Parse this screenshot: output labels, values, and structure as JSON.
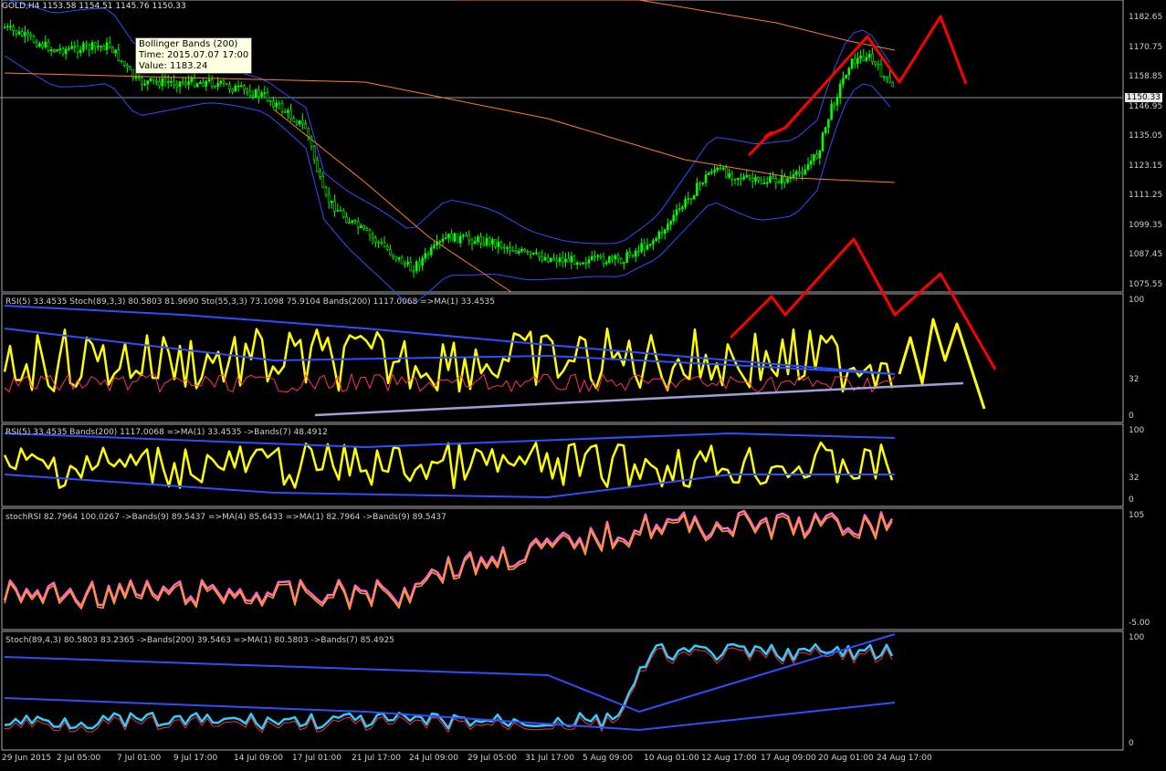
{
  "header": {
    "title": "GOLD,H4  1153.58 1154.51 1145.76 1150.33"
  },
  "tooltip": {
    "line1": "Bollinger Bands (200)",
    "line2": "Time: 2015.07.07 17:00",
    "line3": "Value: 1183.24"
  },
  "current_price": "1150.33",
  "panes": {
    "rsi_stoch": "RSI(5) 33.4535  Stoch(89,3,3) 80.5803 81.9690  Sto(55,3,3) 73.1098 75.9104  Bands(200) 1117.0068  =>MA(1) 33.4535",
    "rsi_bands": "RSI(5) 33.4535  Bands(200) 1117.0068  =>MA(1) 33.4535  ->Bands(7) 48.4912",
    "stoch_rsi": "stochRSI 82.7964 100.0267  ->Bands(9) 89.5437  =>MA(4) 85.6433  =>MA(1) 82.7964  ->Bands(9) 89.5437",
    "stoch": "Stoch(89,4,3) 80.5803 83.2365  ->Bands(200) 39.5463  =>MA(1) 80.5803  ->Bands(7) 85.4925"
  },
  "price_axis": [
    "1182.65",
    "1170.75",
    "1158.85",
    "1146.95",
    "1135.05",
    "1123.15",
    "1111.25",
    "1099.35",
    "1087.45",
    "1075.55"
  ],
  "rsi_axis": [
    "100",
    "32",
    "0"
  ],
  "rsi2_axis": [
    "100",
    "32",
    "0"
  ],
  "stochrsi_axis": [
    "105",
    "-5.00"
  ],
  "stoch_axis": [
    "100",
    "0"
  ],
  "time_axis": [
    "29 Jun 2015",
    "2 Jul 05:00",
    "7 Jul 01:00",
    "9 Jul 17:00",
    "14 Jul 09:00",
    "17 Jul 01:00",
    "21 Jul 17:00",
    "24 Jul 09:00",
    "29 Jul 05:00",
    "31 Jul 17:00",
    "5 Aug 09:00",
    "10 Aug 01:00",
    "12 Aug 17:00",
    "17 Aug 09:00",
    "20 Aug 01:00",
    "24 Aug 17:00"
  ],
  "colors": {
    "up_candle": "#00ff00",
    "band": "#2f4fff",
    "ma": "#ff7f27",
    "rsi": "#ffff00",
    "arrow": "#ff0000",
    "trend": "#a0a0d8"
  },
  "chart_data": {
    "type": "line",
    "x": [
      "29 Jun 2015",
      "2 Jul 05:00",
      "7 Jul 01:00",
      "9 Jul 17:00",
      "14 Jul 09:00",
      "17 Jul 01:00",
      "21 Jul 17:00",
      "24 Jul 09:00",
      "29 Jul 05:00",
      "31 Jul 17:00",
      "5 Aug 09:00",
      "10 Aug 01:00",
      "12 Aug 17:00",
      "17 Aug 09:00",
      "20 Aug 01:00",
      "24 Aug 17:00"
    ],
    "series": [
      {
        "name": "GOLD,H4",
        "values": [
          1180,
          1175,
          1170,
          1163,
          1158,
          1145,
          1100,
          1095,
          1095,
          1092,
          1088,
          1095,
          1118,
          1117,
          1165,
          1150
        ]
      }
    ],
    "ylim": [
      1075.55,
      1182.65
    ]
  }
}
